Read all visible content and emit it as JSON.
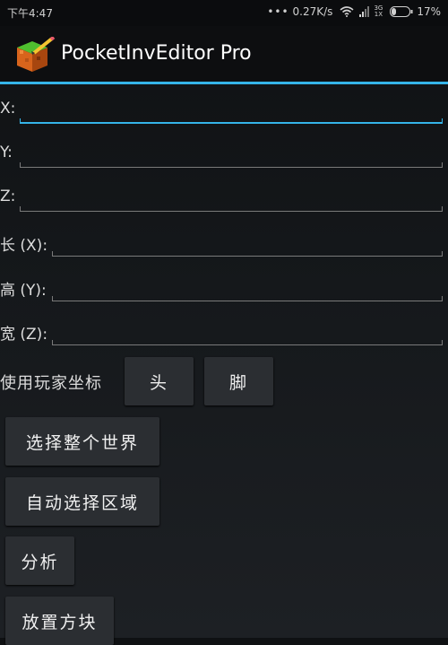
{
  "status_bar": {
    "time": "下午4:47",
    "dots": "•••",
    "speed": "0.27K/s",
    "network_top": "3G",
    "network_bottom": "1X",
    "battery": "17%"
  },
  "app_bar": {
    "title": "PocketInvEditor Pro",
    "accent_color": "#35b4e8"
  },
  "form": {
    "fields": [
      {
        "label": "X:",
        "value": "",
        "focused": true
      },
      {
        "label": "Y:",
        "value": ""
      },
      {
        "label": "Z:",
        "value": ""
      },
      {
        "label": "长 (X):",
        "value": ""
      },
      {
        "label": "高 (Y):",
        "value": ""
      },
      {
        "label": "宽 (Z):",
        "value": ""
      }
    ]
  },
  "player_coords": {
    "label": "使用玩家坐标",
    "head_button": "头",
    "feet_button": "脚"
  },
  "actions": {
    "select_world": "选择整个世界",
    "auto_select": "自动选择区域",
    "analyze": "分析",
    "place_block": "放置方块"
  }
}
